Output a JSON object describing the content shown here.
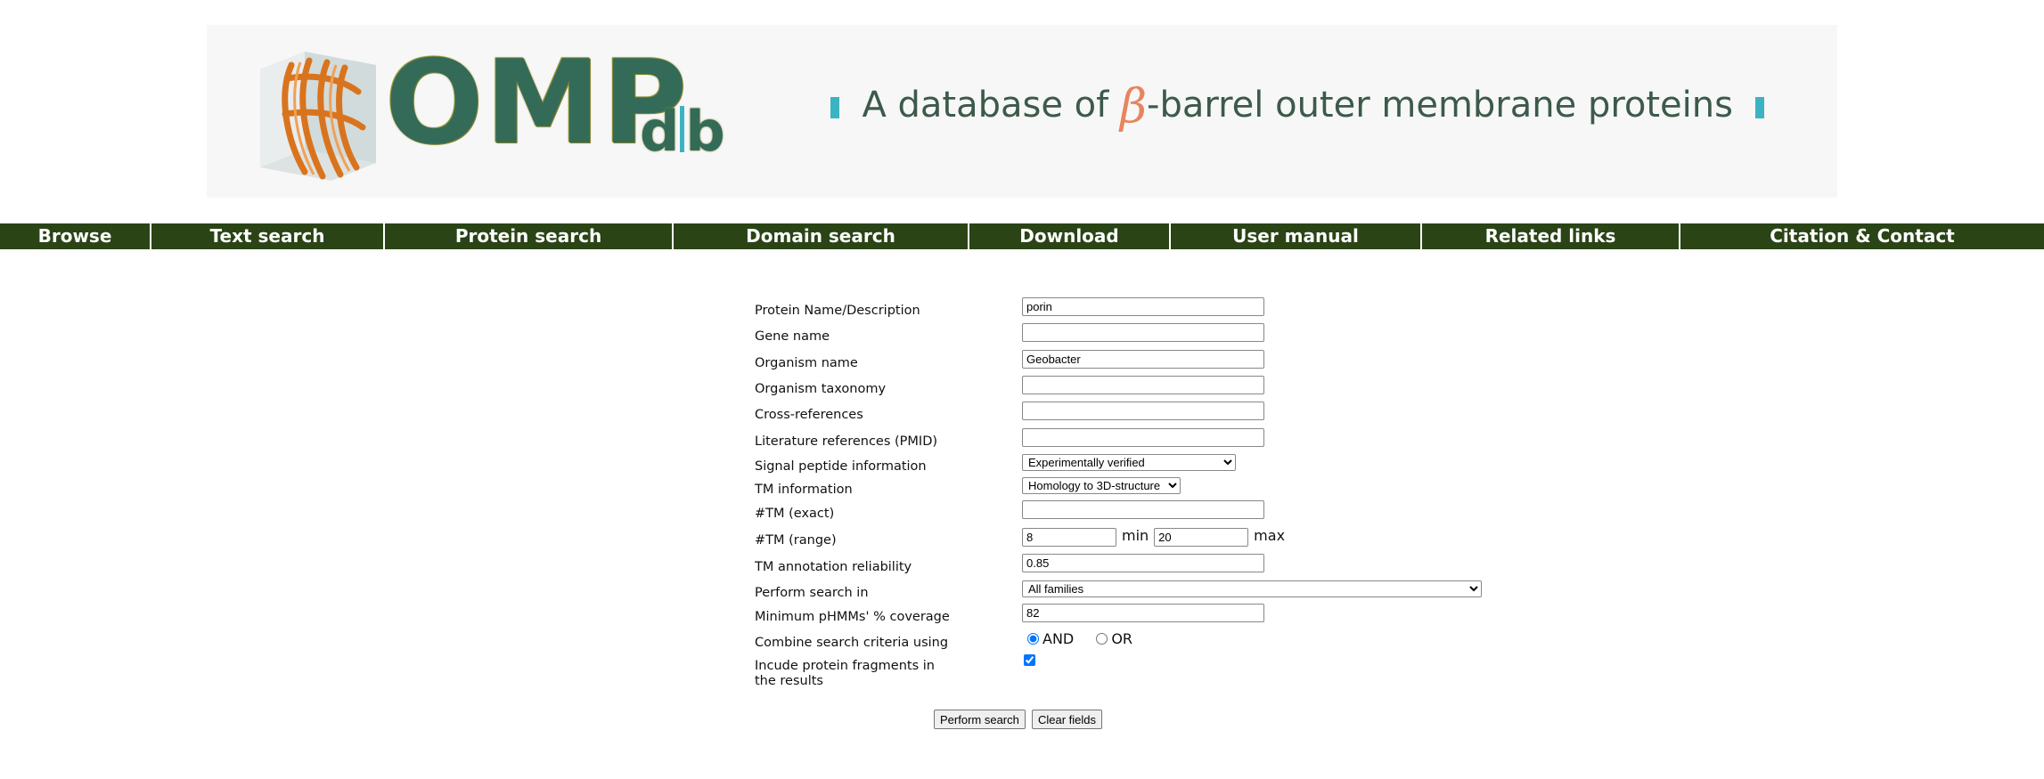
{
  "banner": {
    "logo_main": "OMP",
    "logo_d": "d",
    "logo_b": "b",
    "tagline_pre": "A database of ",
    "tagline_beta": "β",
    "tagline_post": "-barrel outer membrane proteins",
    "accent_color": "#3bb3c3",
    "logo_color": "#336b58",
    "beta_color": "#e8845e"
  },
  "nav": {
    "background": "#2a4416",
    "items": [
      {
        "label": "Browse"
      },
      {
        "label": "Text search"
      },
      {
        "label": "Protein search"
      },
      {
        "label": "Domain search"
      },
      {
        "label": "Download"
      },
      {
        "label": "User manual"
      },
      {
        "label": "Related links"
      },
      {
        "label": "Citation & Contact"
      }
    ]
  },
  "form": {
    "protein_name": {
      "label": "Protein Name/Description",
      "value": "porin"
    },
    "gene_name": {
      "label": "Gene name",
      "value": ""
    },
    "organism_name": {
      "label": "Organism name",
      "value": "Geobacter"
    },
    "organism_taxonomy": {
      "label": "Organism taxonomy",
      "value": ""
    },
    "cross_references": {
      "label": "Cross-references",
      "value": ""
    },
    "literature_references": {
      "label": "Literature references (PMID)",
      "value": ""
    },
    "signal_peptide": {
      "label": "Signal peptide information",
      "selected": "Experimentally verified"
    },
    "tm_information": {
      "label": "TM information",
      "selected": "Homology to 3D-structure"
    },
    "tm_exact": {
      "label": "#TM (exact)",
      "value": ""
    },
    "tm_range": {
      "label": "#TM (range)",
      "min_value": "8",
      "min_label": "min",
      "max_value": "20",
      "max_label": "max"
    },
    "tm_reliability": {
      "label": "TM annotation reliability",
      "value": "0.85"
    },
    "search_in": {
      "label": "Perform search in",
      "selected": "All families"
    },
    "min_coverage": {
      "label": "Minimum pHMMs' % coverage",
      "value": "82"
    },
    "combine": {
      "label": "Combine search criteria using",
      "and_label": "AND",
      "or_label": "OR",
      "selected": "AND"
    },
    "fragments": {
      "label_line1": "Incude protein fragments in",
      "label_line2": "the results",
      "checked": true
    },
    "perform_button": "Perform search",
    "clear_button": "Clear fields"
  }
}
